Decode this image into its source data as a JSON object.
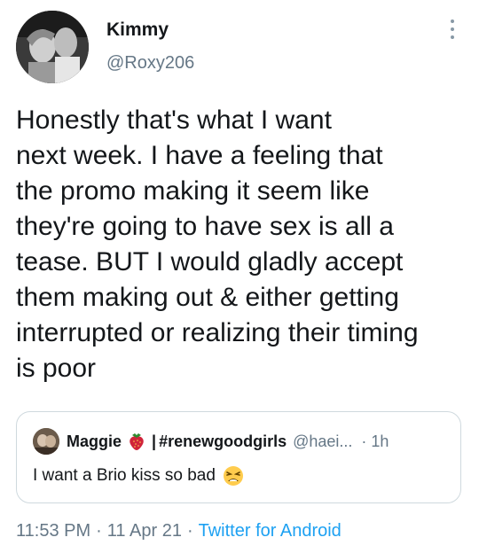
{
  "author": {
    "name": "Kimmy",
    "handle": "@Roxy206"
  },
  "tweet": {
    "lines": [
      "Honestly that's what I want",
      "next week. I have a feeling that",
      "the promo making it seem like",
      "they're going to have sex is all a",
      "tease. BUT I would gladly accept",
      "them making out & either getting",
      "interrupted or realizing their timing",
      "is poor"
    ]
  },
  "quote": {
    "name": "Maggie",
    "separator": "|",
    "hashtag": "#renewgoodgirls",
    "handle": "@haei...",
    "dot": "·",
    "time": "1h",
    "text": "I want a Brio kiss so bad",
    "emoji_name": "weary-face-icon",
    "badge_icon": "strawberry-icon"
  },
  "meta": {
    "time": "11:53 PM",
    "dot1": "·",
    "date": "11 Apr 21",
    "dot2": "·",
    "client": "Twitter for Android"
  },
  "colors": {
    "text": "#14171a",
    "secondary": "#657786",
    "link": "#1da1f2",
    "border": "#cfd9de"
  },
  "icons": {
    "more": "more-vertical-icon"
  }
}
